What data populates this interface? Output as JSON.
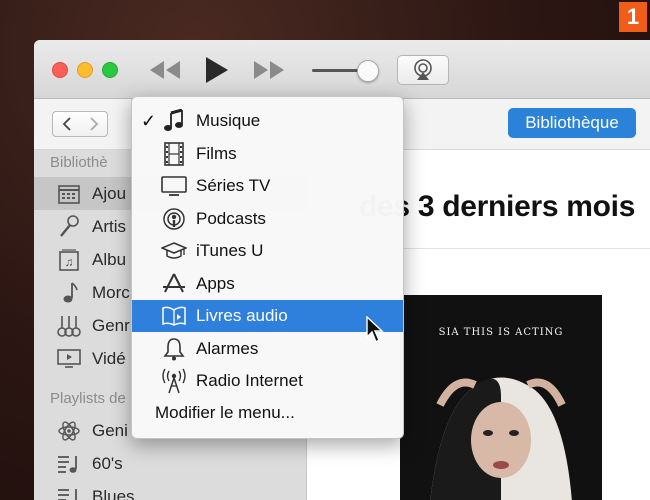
{
  "step_badge": "1",
  "colors": {
    "accent": "#2b82d9",
    "highlight": "#2f7fdc",
    "badge": "#f25c19"
  },
  "toolbar": {
    "library_button": "Bibliothèque"
  },
  "sidebar": {
    "library_header": "Bibliothè",
    "playlists_header": "Playlists de",
    "library_items": [
      {
        "label": "Ajou",
        "icon": "calendar-icon"
      },
      {
        "label": "Artis",
        "icon": "microphone-icon"
      },
      {
        "label": "Albu",
        "icon": "album-icon"
      },
      {
        "label": "Morc",
        "icon": "music-note-icon"
      },
      {
        "label": "Genr",
        "icon": "guitars-icon"
      },
      {
        "label": "Vidé",
        "icon": "monitor-icon"
      }
    ],
    "playlist_items": [
      {
        "label": "Geni",
        "icon": "atom-icon"
      },
      {
        "label": "60's",
        "icon": "playlist-icon"
      },
      {
        "label": "Blues",
        "icon": "playlist-icon"
      }
    ]
  },
  "content": {
    "heading": "des 3 derniers mois",
    "album_title": "SIA THIS IS ACTING"
  },
  "menu": {
    "items": [
      {
        "label": "Musique",
        "icon": "music-note-icon",
        "checked": true
      },
      {
        "label": "Films",
        "icon": "film-icon"
      },
      {
        "label": "Séries TV",
        "icon": "tv-icon"
      },
      {
        "label": "Podcasts",
        "icon": "podcast-icon"
      },
      {
        "label": "iTunes U",
        "icon": "graduation-cap-icon"
      },
      {
        "label": "Apps",
        "icon": "app-store-icon"
      },
      {
        "label": "Livres audio",
        "icon": "audiobook-icon",
        "highlighted": true
      },
      {
        "label": "Alarmes",
        "icon": "bell-icon"
      },
      {
        "label": "Radio Internet",
        "icon": "radio-antenna-icon"
      }
    ],
    "checkmark": "✓",
    "edit_label": "Modifier le menu..."
  }
}
